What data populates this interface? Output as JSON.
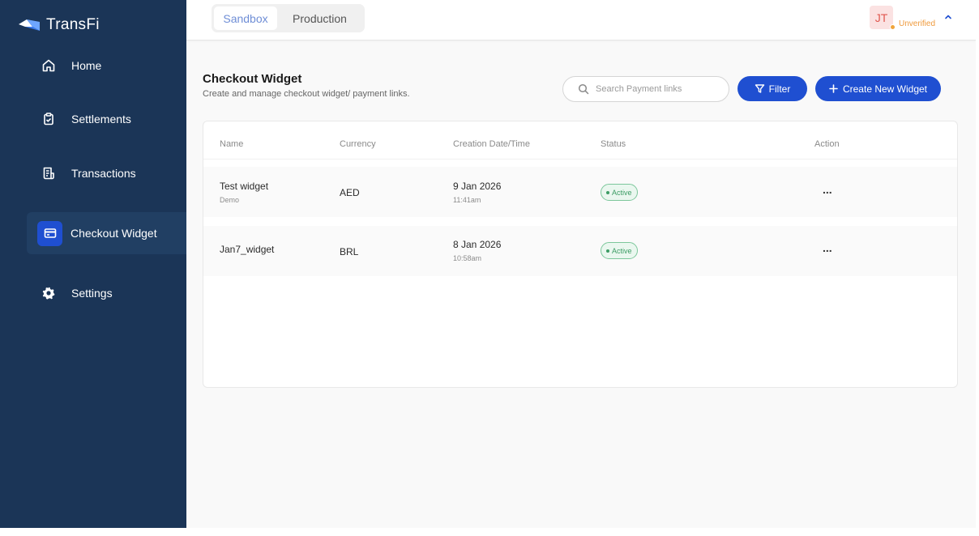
{
  "app": {
    "name": "TransFi",
    "brand_color": "#1f4fd1",
    "sidebar_color": "#1b3557"
  },
  "sidebar": {
    "items": [
      {
        "label": "Home",
        "icon": "home-icon"
      },
      {
        "label": "Settlements",
        "icon": "clipboard-check-icon"
      },
      {
        "label": "Transactions",
        "icon": "document-list-icon"
      },
      {
        "label": "Checkout Widget",
        "icon": "credit-card-icon",
        "active": true
      },
      {
        "label": "Settings",
        "icon": "gear-icon"
      }
    ]
  },
  "topbar": {
    "environments": [
      "Sandbox",
      "Production"
    ],
    "selected_environment": "Sandbox",
    "user": {
      "initials": "JT",
      "status": "Unverified",
      "status_color": "#ef9a3c"
    }
  },
  "page": {
    "title": "Checkout Widget",
    "subtitle": "Create and manage checkout widget/ payment links.",
    "search_placeholder": "Search Payment links",
    "filter_label": "Filter",
    "create_label": "Create New Widget"
  },
  "table": {
    "columns": [
      "Name",
      "Currency",
      "Creation Date/Time",
      "Status",
      "Action"
    ],
    "rows": [
      {
        "name": "Test widget",
        "name_sub": "Demo",
        "currency": "AED",
        "date": "9 Jan 2026",
        "time": "11:41am",
        "status": "Active",
        "action": "..."
      },
      {
        "name": "Jan7_widget",
        "name_sub": "",
        "currency": "BRL",
        "date": "8 Jan 2026",
        "time": "10:58am",
        "status": "Active",
        "action": "..."
      }
    ]
  }
}
